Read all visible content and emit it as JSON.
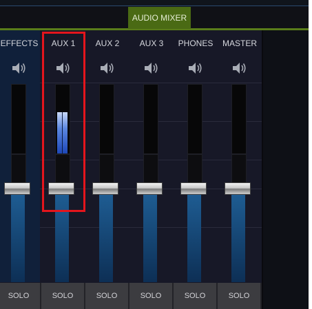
{
  "tabs": {
    "active_label": "AUDIO MIXER"
  },
  "channels": [
    {
      "label": "EFFECTS",
      "solo": "SOLO",
      "meter_level": 0,
      "icon": "speaker-icon"
    },
    {
      "label": "AUX 1",
      "solo": "SOLO",
      "meter_level": 0.6,
      "icon": "speaker-icon"
    },
    {
      "label": "AUX 2",
      "solo": "SOLO",
      "meter_level": 0,
      "icon": "speaker-icon"
    },
    {
      "label": "AUX 3",
      "solo": "SOLO",
      "meter_level": 0,
      "icon": "speaker-icon"
    },
    {
      "label": "PHONES",
      "solo": "SOLO",
      "meter_level": 0,
      "icon": "speaker-icon"
    },
    {
      "label": "MASTER",
      "solo": "SOLO",
      "meter_level": 0,
      "icon": "speaker-icon"
    }
  ],
  "colors": {
    "accent": "#5a7d1a",
    "highlight": "#e5151c",
    "meter": "#5b87e0"
  }
}
